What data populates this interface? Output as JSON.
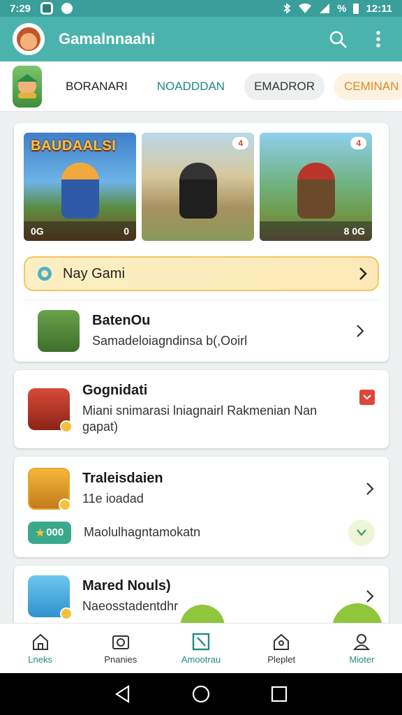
{
  "status_bar": {
    "time": "7:29",
    "battery": "%",
    "clock": "12:11"
  },
  "app_bar": {
    "title": "Gamalnnaahi"
  },
  "categories": {
    "tabs": [
      {
        "label": "BORANARI"
      },
      {
        "label": "NOADDDAN"
      },
      {
        "label": "EMADROR"
      },
      {
        "label": "CEMINAN"
      }
    ]
  },
  "hero": {
    "thumbs": [
      {
        "title": "BAUDAALSI",
        "footer_left": "0G",
        "footer_right": "0"
      },
      {
        "badge": "4"
      },
      {
        "badge": "4",
        "footer_right": "8 0G"
      }
    ],
    "banner_label": "Nay Gami"
  },
  "list": [
    {
      "title": "BatenOu",
      "subtitle": "Samadeloiagndinsa b(,Ooirl"
    },
    {
      "title": "Gognidati",
      "subtitle": "Miani snimarasi lniagnairl Rakmenian Nan gapat)"
    },
    {
      "title": "Traleisdaien",
      "subtitle": "11e ioadad",
      "count_label": "000",
      "extra_text": "Maolulhagntamokatn"
    },
    {
      "title": "Mared Nouls)",
      "subtitle": "Naeosstadentdhr"
    }
  ],
  "bottom_nav": [
    {
      "label": "Lneks",
      "icon": "home-icon"
    },
    {
      "label": "Pnanies",
      "icon": "camera-icon"
    },
    {
      "label": "Amootrau",
      "icon": "edit-icon"
    },
    {
      "label": "Pleplet",
      "icon": "house-icon"
    },
    {
      "label": "Mioter",
      "icon": "profile-icon"
    }
  ],
  "colors": {
    "primary": "#4bb3ad",
    "status": "#3a9e9a",
    "accent_orange": "#e08a1e",
    "fab_green": "#8fc63c"
  }
}
